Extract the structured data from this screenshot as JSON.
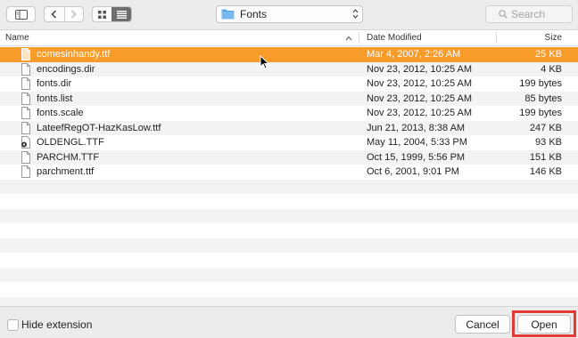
{
  "toolbar": {
    "location_label": "Fonts",
    "search_placeholder": "Search"
  },
  "table": {
    "columns": {
      "name": "Name",
      "date": "Date Modified",
      "size": "Size"
    },
    "rows": [
      {
        "name": "comesinhandy.ttf",
        "date": "Mar 4, 2007, 2:26 AM",
        "size": "25 KB",
        "icon": "document-icon",
        "selected": true
      },
      {
        "name": "encodings.dir",
        "date": "Nov 23, 2012, 10:25 AM",
        "size": "4 KB",
        "icon": "document-icon"
      },
      {
        "name": "fonts.dir",
        "date": "Nov 23, 2012, 10:25 AM",
        "size": "199 bytes",
        "icon": "document-icon"
      },
      {
        "name": "fonts.list",
        "date": "Nov 23, 2012, 10:25 AM",
        "size": "85 bytes",
        "icon": "document-icon"
      },
      {
        "name": "fonts.scale",
        "date": "Nov 23, 2012, 10:25 AM",
        "size": "199 bytes",
        "icon": "document-icon"
      },
      {
        "name": "LateefRegOT-HazKasLow.ttf",
        "date": "Jun 21, 2013, 8:38 AM",
        "size": "247 KB",
        "icon": "document-icon"
      },
      {
        "name": "OLDENGL.TTF",
        "date": "May 11, 2004, 5:33 PM",
        "size": "93 KB",
        "icon": "font-file-icon"
      },
      {
        "name": "PARCHM.TTF",
        "date": "Oct 15, 1999, 5:56 PM",
        "size": "151 KB",
        "icon": "document-icon"
      },
      {
        "name": "parchment.ttf",
        "date": "Oct 6, 2001, 9:01 PM",
        "size": "146 KB",
        "icon": "document-icon"
      }
    ]
  },
  "footer": {
    "hide_extension_label": "Hide extension",
    "cancel_label": "Cancel",
    "open_label": "Open"
  },
  "colors": {
    "selection": "#f79b2a",
    "folder": "#5fa7e8",
    "focus_highlight": "#e53935"
  }
}
